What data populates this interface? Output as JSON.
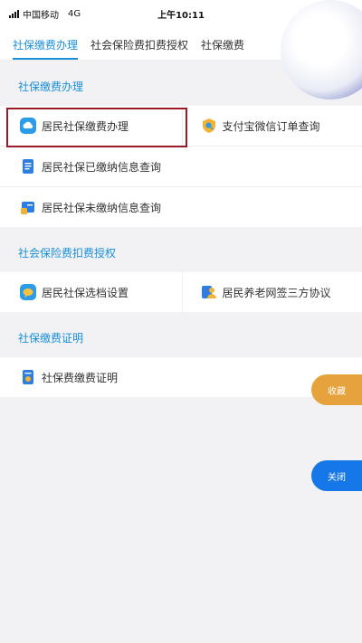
{
  "status_bar": {
    "carrier": "中国移动",
    "network": "4G",
    "time": "上午10:11"
  },
  "tabs": [
    {
      "label": "社保缴费办理",
      "active": true
    },
    {
      "label": "社会保险费扣费授权",
      "active": false
    },
    {
      "label": "社保缴费",
      "active": false
    }
  ],
  "sections": [
    {
      "title": "社保缴费办理",
      "rows": [
        [
          {
            "label": "居民社保缴费办理",
            "icon": "cloud-icon"
          },
          {
            "label": "支付宝微信订单查询",
            "icon": "shield-search-icon"
          }
        ],
        [
          {
            "label": "居民社保已缴纳信息查询",
            "icon": "document-icon"
          }
        ],
        [
          {
            "label": "居民社保未缴纳信息查询",
            "icon": "card-icon"
          }
        ]
      ]
    },
    {
      "title": "社会保险费扣费授权",
      "rows": [
        [
          {
            "label": "居民社保选档设置",
            "icon": "chat-icon"
          },
          {
            "label": "居民养老网签三方协议",
            "icon": "people-icon"
          }
        ]
      ]
    },
    {
      "title": "社保缴费证明",
      "rows": [
        [
          {
            "label": "社保费缴费证明",
            "icon": "certificate-icon"
          }
        ]
      ]
    }
  ],
  "fab": {
    "favorite": "收藏",
    "close": "关闭"
  },
  "colors": {
    "accent": "#1a8fd8",
    "highlight": "#9b1a2a",
    "favorite": "#e6a23c",
    "close": "#1677e8"
  }
}
